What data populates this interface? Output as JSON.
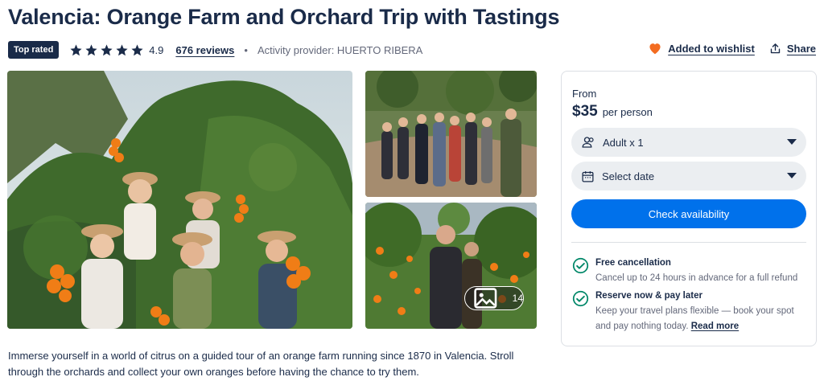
{
  "header": {
    "title": "Valencia: Orange Farm and Orchard Trip with Tastings",
    "badge": "Top rated",
    "rating": "4.9",
    "reviews": "676 reviews",
    "separator": "•",
    "provider": "Activity provider: HUERTO RIBERA",
    "stars": 5
  },
  "actions": {
    "wishlist": "Added to wishlist",
    "share": "Share"
  },
  "gallery": {
    "photo_count": "14"
  },
  "booking": {
    "from_label": "From",
    "price": "$35",
    "per_person": "per person",
    "participants": "Adult x 1",
    "date_placeholder": "Select date",
    "check_button": "Check availability",
    "features": [
      {
        "title": "Free cancellation",
        "desc": "Cancel up to 24 hours in advance for a full refund"
      },
      {
        "title": "Reserve now & pay later",
        "desc": "Keep your travel plans flexible — book your spot and pay nothing today.",
        "link": "Read more"
      }
    ]
  },
  "description": "Immerse yourself in a world of citrus on a guided tour of an orange farm running since 1870 in Valencia. Stroll through the orchards and collect your own oranges before having the chance to try them.",
  "colors": {
    "navy": "#1a2b49",
    "primary": "#0071eb",
    "wishlist_heart": "#f36c21",
    "check_green": "#008768"
  }
}
